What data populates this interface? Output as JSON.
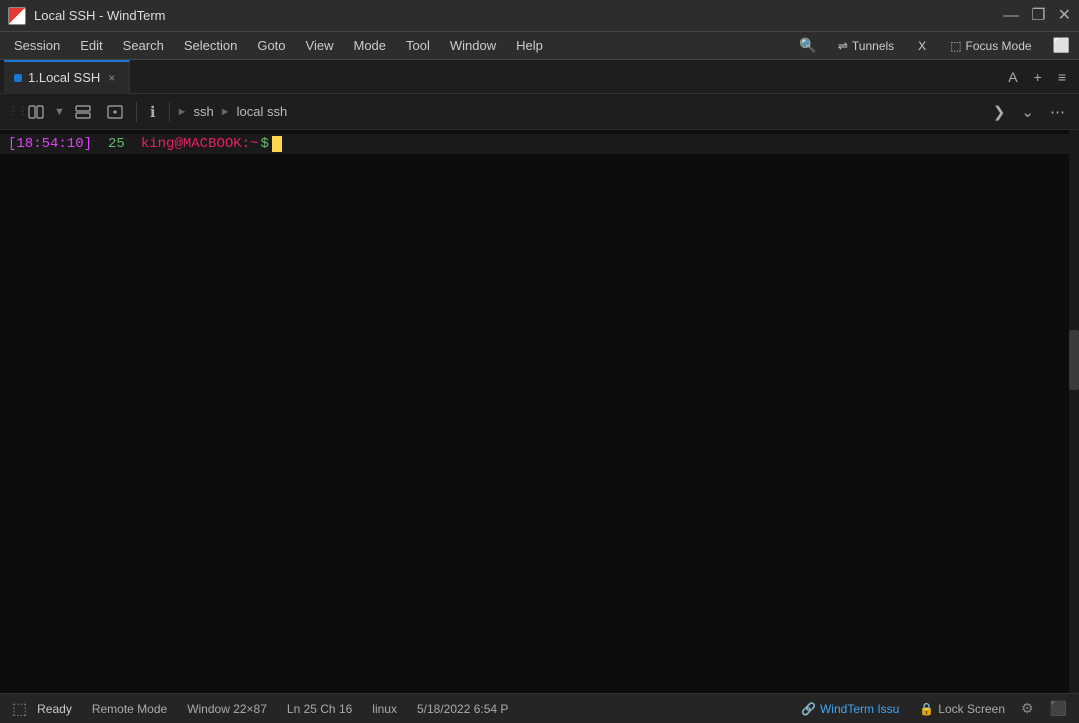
{
  "window": {
    "title": "Local SSH - WindTerm",
    "controls": {
      "minimize": "—",
      "restore": "❐",
      "close": "✕"
    }
  },
  "menu": {
    "items": [
      "Session",
      "Edit",
      "Search",
      "Selection",
      "Goto",
      "View",
      "Mode",
      "Tool",
      "Window",
      "Help"
    ],
    "right": {
      "search_icon": "🔍",
      "tunnels_label": "Tunnels",
      "x_label": "X",
      "focus_mode_label": "Focus Mode",
      "expand_icon": "⬜"
    }
  },
  "tabs": {
    "active": {
      "indicator_color": "#1976d2",
      "label": "1.Local SSH",
      "close": "×"
    },
    "right_buttons": {
      "A_label": "A",
      "plus_label": "+",
      "menu_label": "≡"
    }
  },
  "toolbar": {
    "breadcrumb": {
      "ssh": "ssh",
      "arrow1": "►",
      "local_ssh": "local ssh",
      "arrow2": "►"
    },
    "right": {
      "forward_icon": "❯",
      "dropdown_icon": "⌄",
      "more_icon": "⋯"
    }
  },
  "terminal": {
    "timestamp": "[18:54:10]",
    "line_number": "25",
    "user": "king",
    "host": "MACBOOK",
    "path": "~",
    "dollar": "$"
  },
  "statusbar": {
    "ready": "Ready",
    "remote_mode": "Remote Mode",
    "window_size": "Window 22×87",
    "cursor_pos": "Ln 25 Ch 16",
    "os": "linux",
    "datetime": "5/18/2022 6:54 P",
    "windterm_icon": "🔗",
    "windterm_link": "WindTerm Issu",
    "lock_icon": "🔒",
    "lock_screen": "Lock Screen",
    "gear_icon": "⚙",
    "settings_icon": "⚙"
  }
}
